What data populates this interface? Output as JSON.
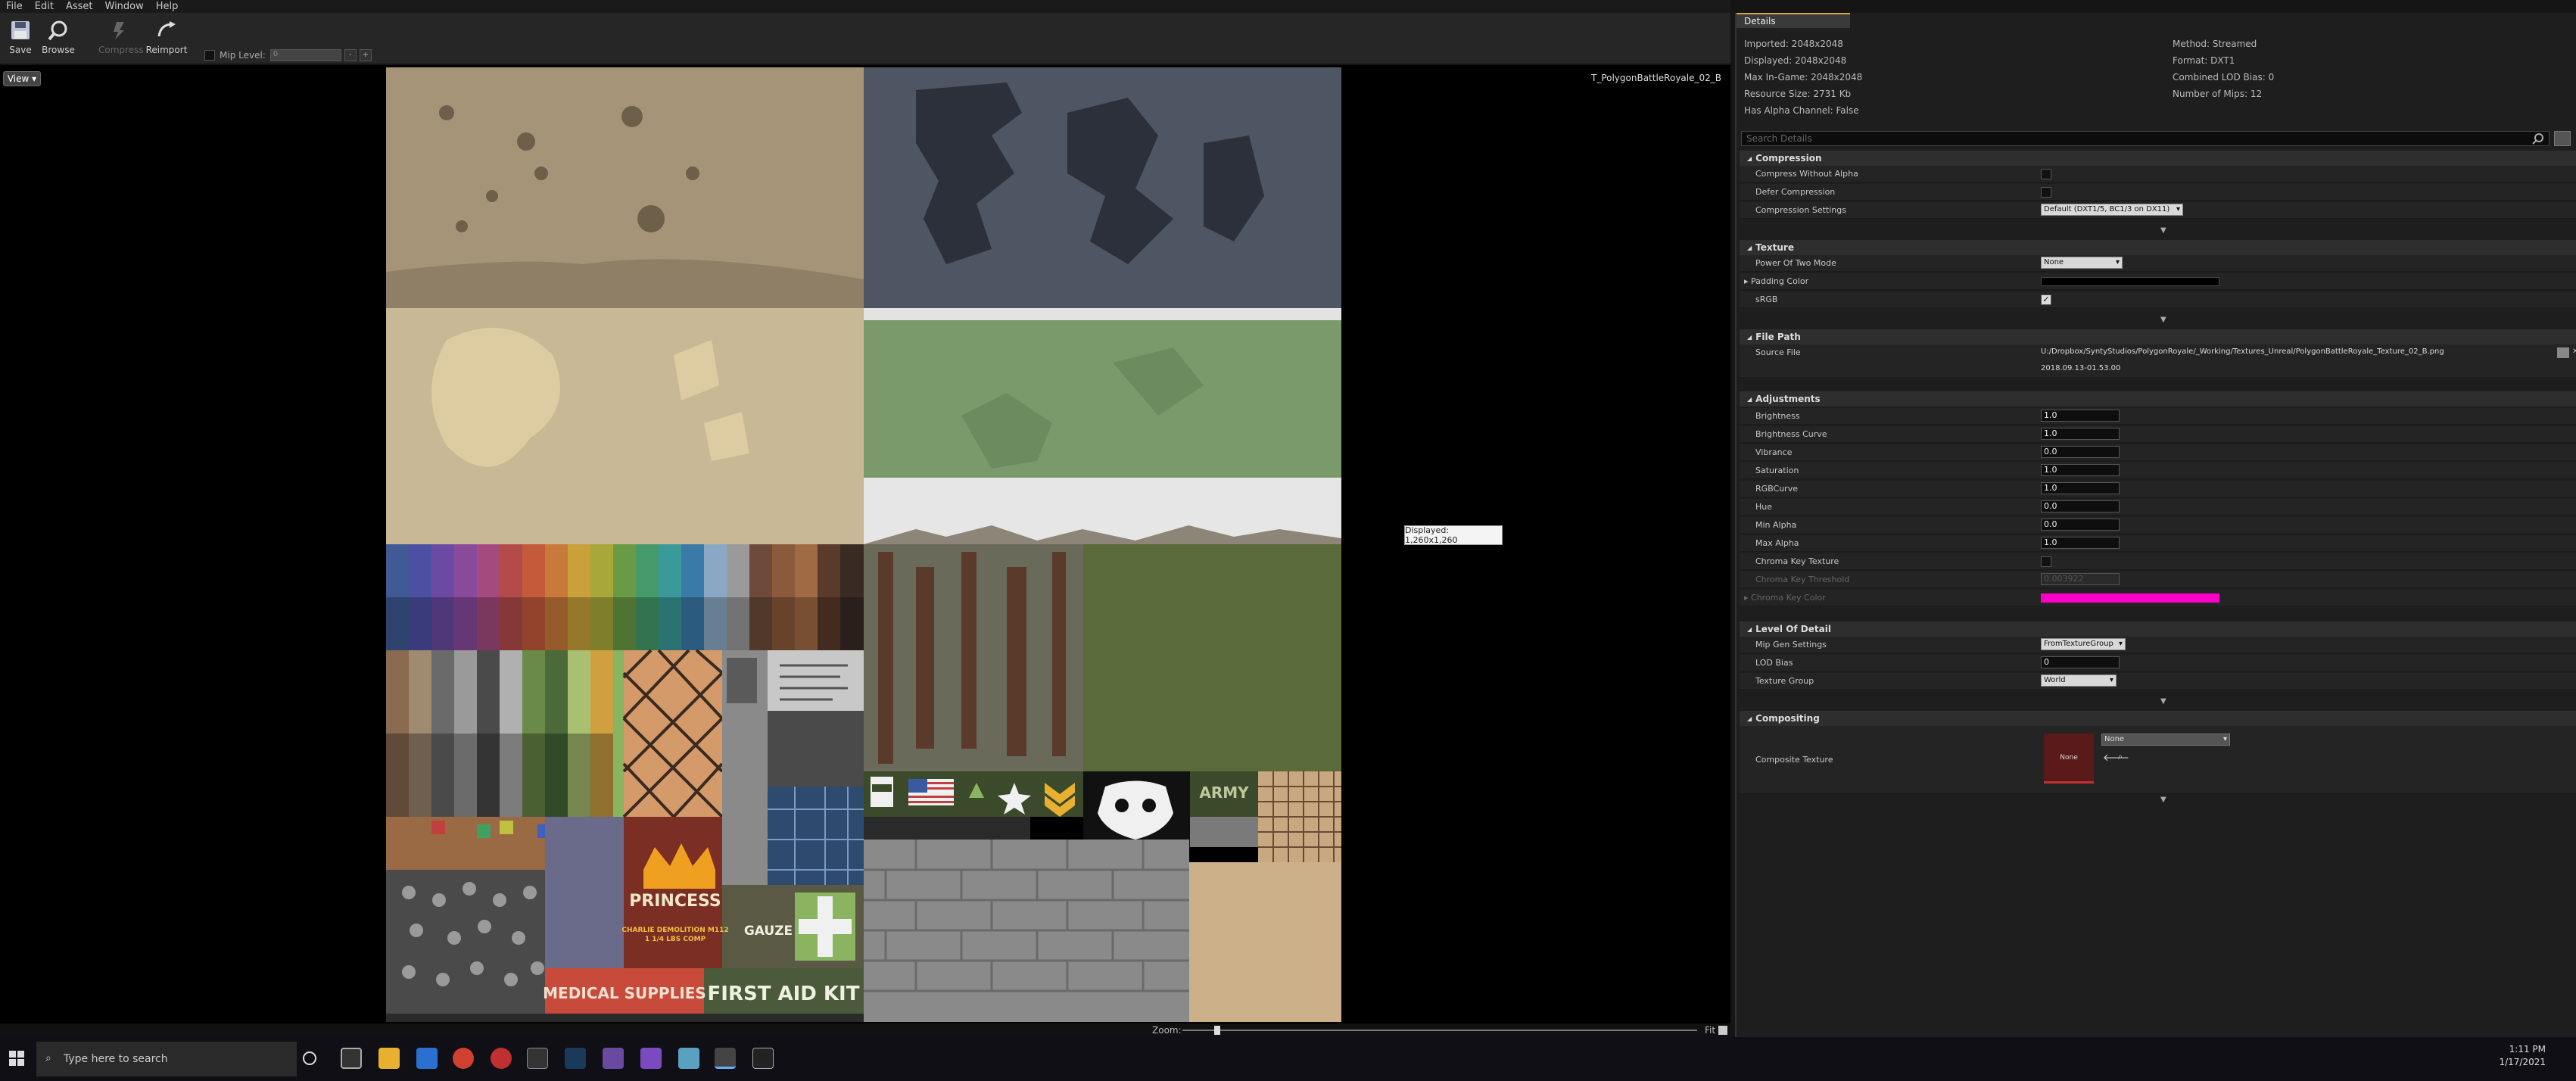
{
  "menu": [
    "File",
    "Edit",
    "Asset",
    "Window",
    "Help"
  ],
  "toolbar": {
    "save": "Save",
    "browse": "Browse",
    "compress": "Compress",
    "reimport": "Reimport",
    "mip_label": "Mip Level:",
    "mip_value": "0"
  },
  "viewport": {
    "view_button": "View",
    "texture_name": "T_PolygonBattleRoyale_02_B",
    "tooltip": "Displayed: 1,260x1,260",
    "zoom_label": "Zoom:",
    "zoom_fit": "Fit"
  },
  "texture_art": {
    "princess": "PRINCESS",
    "charlie": "CHARLIE DEMOLITION M112",
    "lbs": "1 1/4 LBS COMP",
    "gauze": "GAUZE",
    "medical": "MEDICAL SUPPLIES",
    "first_aid": "FIRST AID KIT",
    "army": "ARMY"
  },
  "details": {
    "tab": "Details",
    "info_left": [
      "Imported: 2048x2048",
      "Displayed: 2048x2048",
      "Max In-Game: 2048x2048",
      "Resource Size: 2731 Kb",
      "Has Alpha Channel: False"
    ],
    "info_right": [
      "Method: Streamed",
      "Format: DXT1",
      "Combined LOD Bias: 0",
      "Number of Mips: 12"
    ],
    "search_placeholder": "Search Details",
    "compression": {
      "title": "Compression",
      "compress_without_alpha": "Compress Without Alpha",
      "defer_compression": "Defer Compression",
      "compression_settings": "Compression Settings",
      "compression_settings_value": "Default (DXT1/5, BC1/3 on DX11)"
    },
    "texture": {
      "title": "Texture",
      "power_of_two": "Power Of Two Mode",
      "power_of_two_value": "None",
      "padding_color": "Padding Color",
      "srgb": "sRGB"
    },
    "file_path": {
      "title": "File Path",
      "source_file": "Source File",
      "source_file_value": "U:/Dropbox/SyntyStudios/PolygonRoyale/_Working/Textures_Unreal/PolygonBattleRoyale_Texture_02_B.png",
      "timestamp": "2018.09.13-01.53.00"
    },
    "adjustments": {
      "title": "Adjustments",
      "rows": [
        {
          "label": "Brightness",
          "value": "1.0"
        },
        {
          "label": "Brightness Curve",
          "value": "1.0"
        },
        {
          "label": "Vibrance",
          "value": "0.0"
        },
        {
          "label": "Saturation",
          "value": "1.0"
        },
        {
          "label": "RGBCurve",
          "value": "1.0"
        },
        {
          "label": "Hue",
          "value": "0.0"
        },
        {
          "label": "Min Alpha",
          "value": "0.0"
        },
        {
          "label": "Max Alpha",
          "value": "1.0"
        }
      ],
      "chroma_key_texture": "Chroma Key Texture",
      "chroma_key_threshold": "Chroma Key Threshold",
      "chroma_key_threshold_value": "0.003922",
      "chroma_key_color": "Chroma Key Color"
    },
    "lod": {
      "title": "Level Of Detail",
      "mip_gen": "Mip Gen Settings",
      "mip_gen_value": "FromTextureGroup",
      "lod_bias": "LOD Bias",
      "lod_bias_value": "0",
      "texture_group": "Texture Group",
      "texture_group_value": "World"
    },
    "compositing": {
      "title": "Compositing",
      "composite_texture": "Composite Texture",
      "none_thumb": "None",
      "none_dd": "None"
    }
  },
  "taskbar": {
    "search": "Type here to search",
    "time": "1:11 PM",
    "date": "1/17/2021"
  },
  "colors": {
    "accent": "#d9a43b",
    "chroma": "#ff00c8",
    "padding": "#000000"
  }
}
